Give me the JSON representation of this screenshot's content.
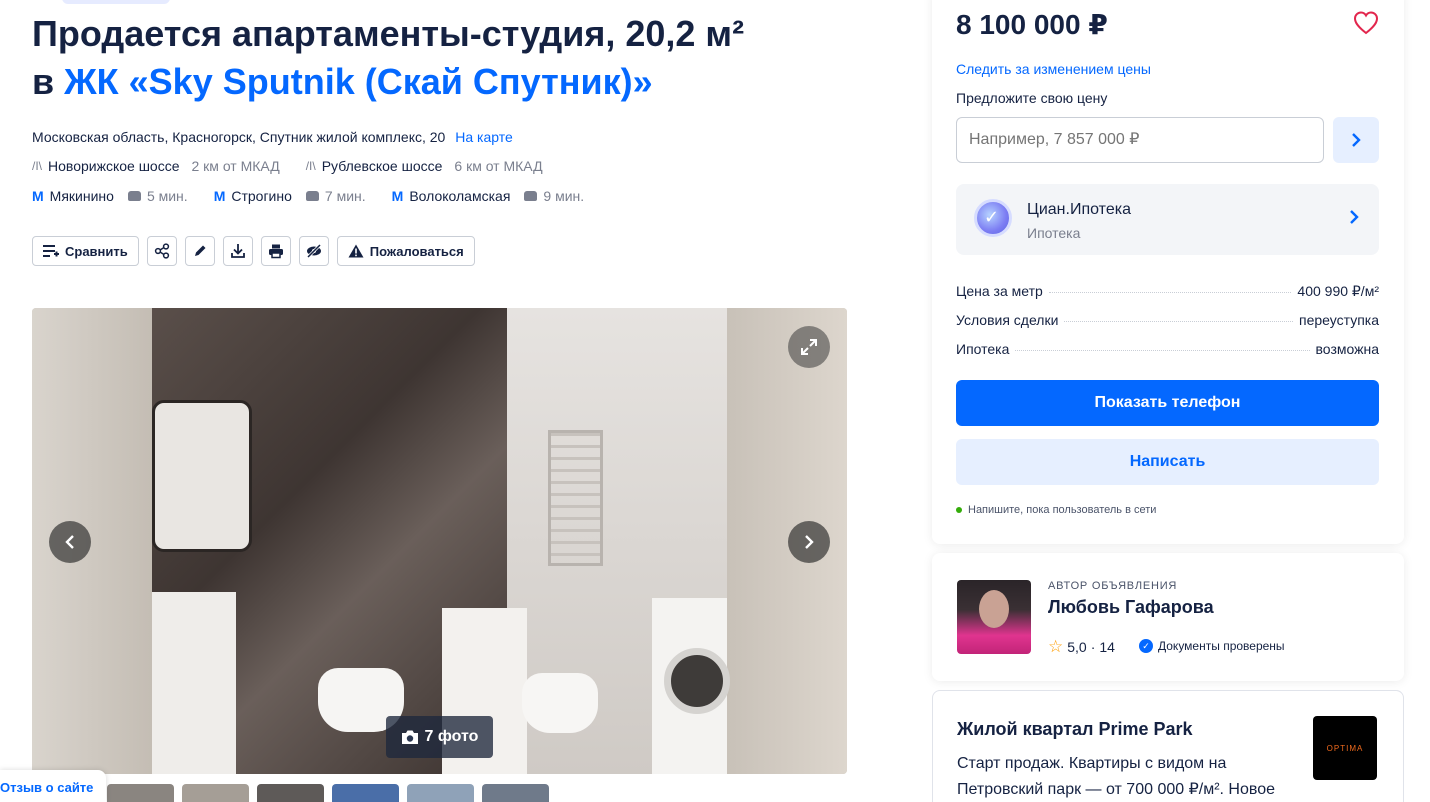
{
  "title": {
    "line1": "Продается апартаменты-студия, 20,2 м²",
    "prefix": "в ",
    "complex_link": "ЖК «Sky Sputnik (Скай Спутник)»"
  },
  "address": {
    "text": "Московская область, Красногорск, Спутник жилой комплекс, 20",
    "map_link": "На карте"
  },
  "roads": [
    {
      "name": "Новорижское шоссе",
      "distance": "2 км от МКАД"
    },
    {
      "name": "Рублевское шоссе",
      "distance": "6 км от МКАД"
    }
  ],
  "metros": [
    {
      "name": "Мякинино",
      "time": "5 мин."
    },
    {
      "name": "Строгино",
      "time": "7 мин."
    },
    {
      "name": "Волоколамская",
      "time": "9 мин."
    }
  ],
  "actions": {
    "compare": "Сравнить",
    "complain": "Пожаловаться"
  },
  "gallery": {
    "photo_count": "7 фото",
    "thumb_colors": [
      "#8a8580",
      "#a59e96",
      "#5e5a58",
      "#4a6ea8",
      "#8fa2b8",
      "#6f7a8a"
    ]
  },
  "review_tab": "Отзыв о сайте",
  "price_card": {
    "price": "8 100 000 ₽",
    "watch_link": "Следить за изменением цены",
    "offer_label": "Предложите свою цену",
    "offer_placeholder": "Например, 7 857 000 ₽",
    "mortgage_title": "Циан.Ипотека",
    "mortgage_sub": "Ипотека",
    "facts": [
      {
        "key": "Цена за метр",
        "value": "400 990 ₽/м²"
      },
      {
        "key": "Условия сделки",
        "value": "переуступка"
      },
      {
        "key": "Ипотека",
        "value": "возможна"
      }
    ],
    "phone_button": "Показать телефон",
    "write_button": "Написать",
    "online_hint": "Напишите, пока пользователь в сети"
  },
  "author": {
    "caption": "Автор объявления",
    "name": "Любовь Гафарова",
    "rating": "5,0",
    "separator": "·",
    "reviews": "14",
    "docs": "Документы проверены"
  },
  "ad": {
    "title": "Жилой квартал Prime Park",
    "text": "Старт продаж. Квартиры с видом на Петровский парк — от 700 000 ₽/м². Новое",
    "logo_text": "OPTIMA"
  },
  "colors": {
    "accent": "#0468ff",
    "text": "#152242",
    "heart": "#e2264d"
  }
}
